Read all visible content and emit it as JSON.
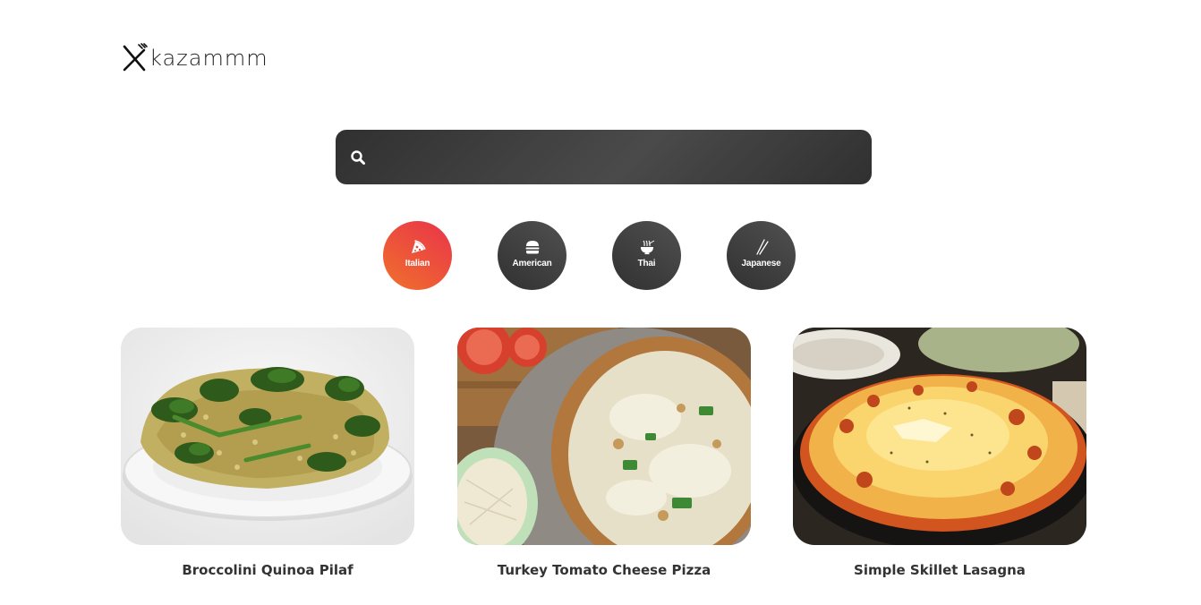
{
  "brand": {
    "name": "kazammm",
    "icon": "fork-knife-icon"
  },
  "search": {
    "placeholder": "",
    "value": "",
    "icon": "search-icon"
  },
  "categories": [
    {
      "label": "Italian",
      "icon": "pizza-icon",
      "active": true
    },
    {
      "label": "American",
      "icon": "burger-icon",
      "active": false
    },
    {
      "label": "Thai",
      "icon": "noodle-bowl-icon",
      "active": false
    },
    {
      "label": "Japanese",
      "icon": "chopsticks-icon",
      "active": false
    }
  ],
  "recipes": [
    {
      "title": "Broccolini Quinoa Pilaf"
    },
    {
      "title": "Turkey Tomato Cheese Pizza"
    },
    {
      "title": "Simple Skillet Lasagna"
    }
  ],
  "colors": {
    "accent_start": "#f0712c",
    "accent_end": "#e9334a",
    "dark": "#3a3a3a"
  }
}
